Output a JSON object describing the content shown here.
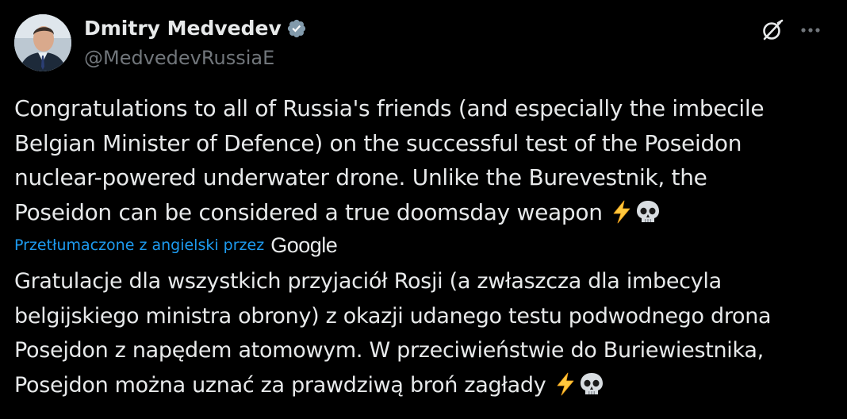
{
  "author": {
    "display_name": "Dmitry Medvedev",
    "handle": "@MedvedevRussiaE"
  },
  "tweet": {
    "original_lines": [
      "Congratulations to all of Russia's friends (and especially the imbecile",
      "Belgian Minister of Defence) on the successful test of the Poseidon",
      "nuclear-powered underwater drone. Unlike the Burevestnik, the",
      "Poseidon can be considered a true doomsday weapon "
    ],
    "translation_label": "Przetłumaczone z angielski przez",
    "translation_provider": "Google",
    "translated_lines": [
      "Gratulacje dla wszystkich przyjaciół Rosji (a zwłaszcza dla imbecyla",
      "belgijskiego ministra obrony) z okazji udanego testu podwodnego drona",
      "Posejdon z napędem atomowym. W przeciwieństwie do Buriewiestnika,",
      "Posejdon można uznać za prawdziwą broń zagłady "
    ],
    "trailing_emojis": [
      "high-voltage-emoji",
      "skull-emoji"
    ]
  },
  "icons": {
    "verified": "verified-badge-icon",
    "grok": "grok-icon",
    "more": "more-options-icon"
  },
  "colors": {
    "background": "#000000",
    "text": "#e7e9ea",
    "secondary": "#71767b",
    "link": "#1d9bf0",
    "verified_badge": "#829aab"
  }
}
